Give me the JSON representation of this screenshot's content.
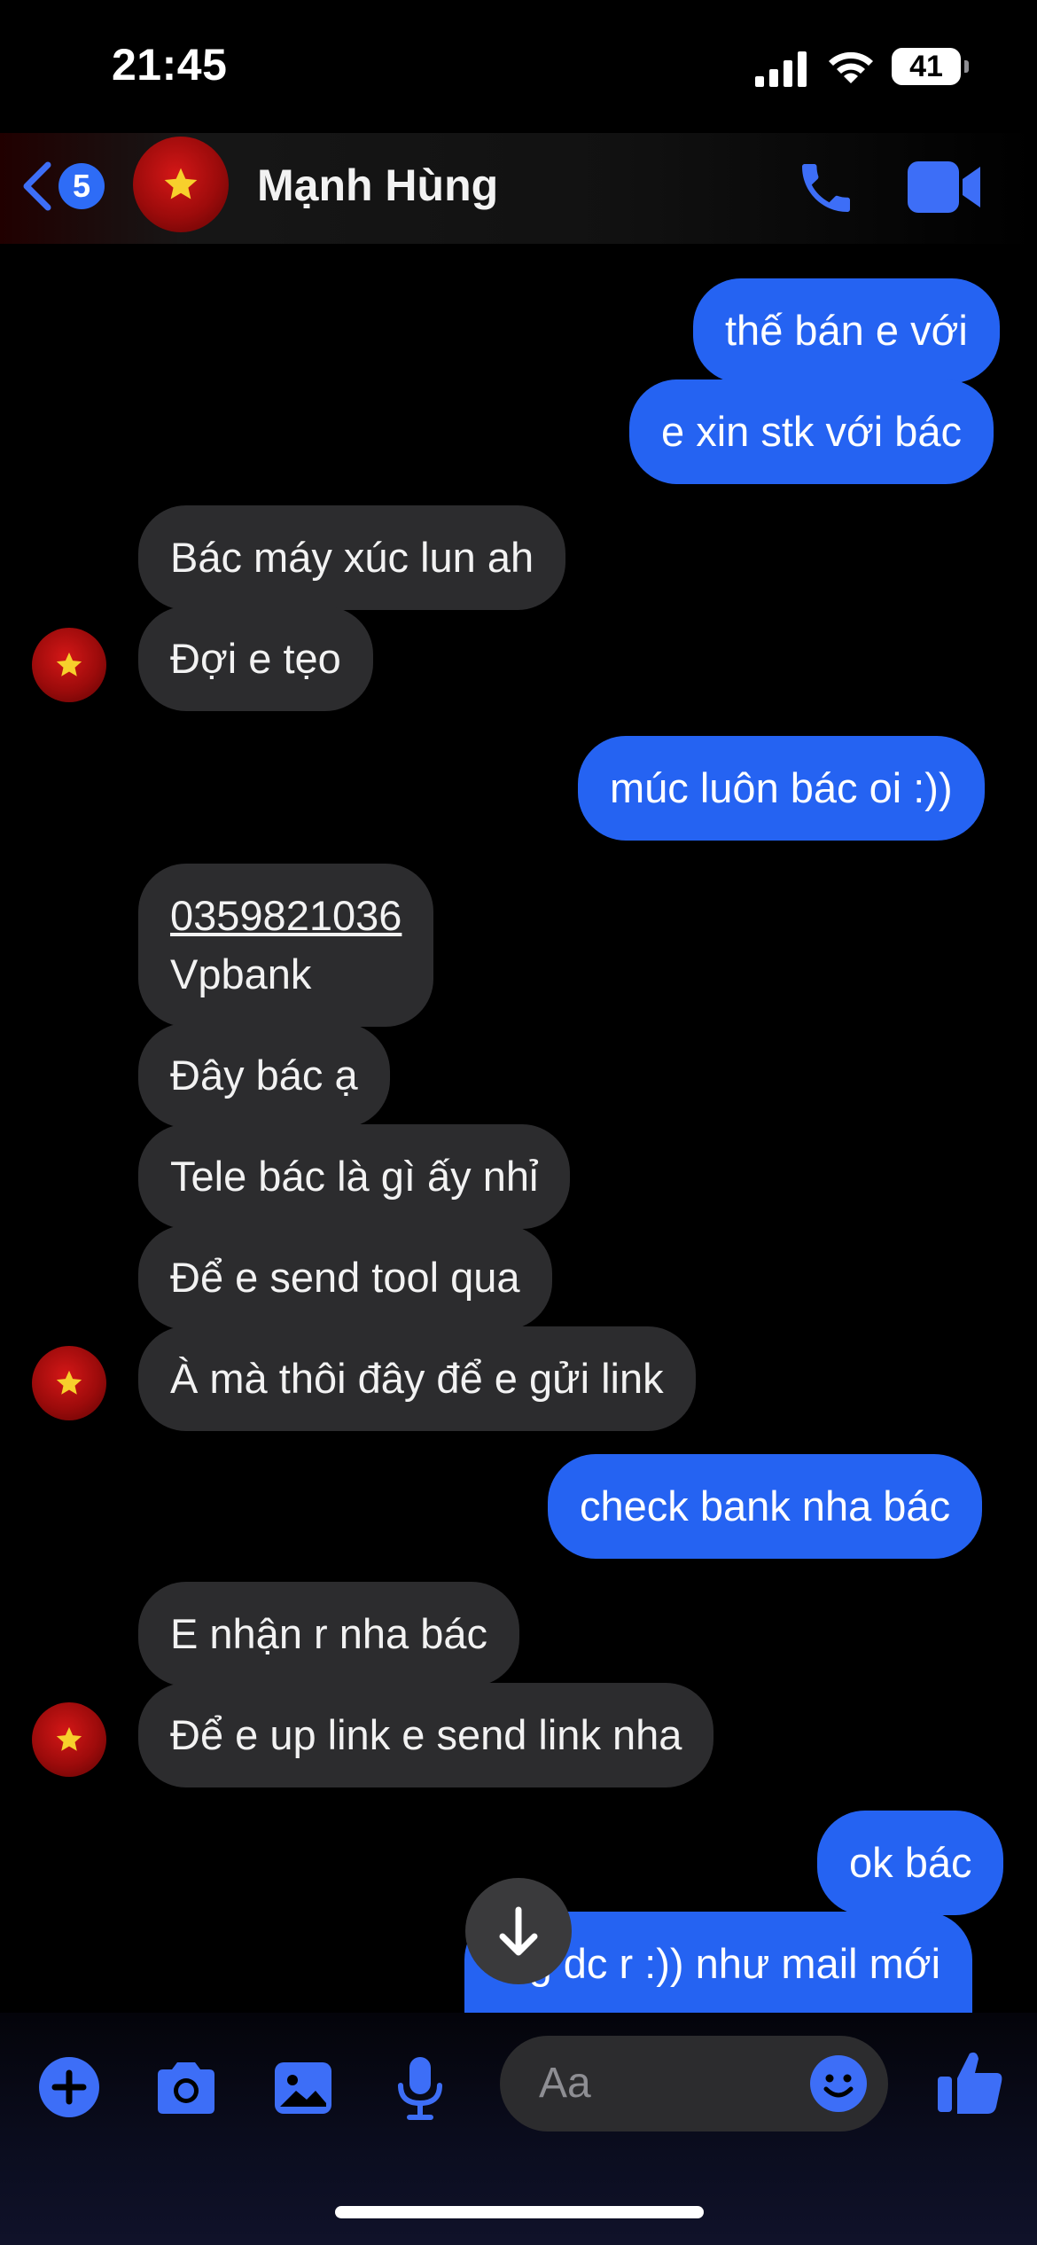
{
  "status_bar": {
    "time": "21:45",
    "battery": "41"
  },
  "header": {
    "back_count": "5",
    "contact_name": "Mạnh Hùng"
  },
  "messages": [
    {
      "from": "me",
      "text": "thế bán e với"
    },
    {
      "from": "me",
      "text": "e xin stk với bác"
    },
    {
      "from": "them",
      "text": "Bác máy xúc lun ah"
    },
    {
      "from": "them",
      "text": "Đợi e tẹo"
    },
    {
      "from": "me",
      "text": "múc luôn bác oi :))"
    },
    {
      "from": "them",
      "phone": "0359821036",
      "text": "Vpbank"
    },
    {
      "from": "them",
      "text": "Đây bác ạ"
    },
    {
      "from": "them",
      "text": "Tele bác là gì ấy nhỉ"
    },
    {
      "from": "them",
      "text": "Để e send tool qua"
    },
    {
      "from": "them",
      "text": "À mà thôi đây để e gửi link"
    },
    {
      "from": "me",
      "text": "check bank nha bác"
    },
    {
      "from": "them",
      "text": "E nhận r nha bác"
    },
    {
      "from": "them",
      "text": "Để e up link e send link nha"
    },
    {
      "from": "me",
      "text": "ok bác"
    },
    {
      "from": "me",
      "text": "log dc r :)) như mail mới"
    }
  ],
  "composer": {
    "placeholder": "Aa"
  },
  "colors": {
    "outgoing": "#2563f2",
    "incoming": "#2c2c2e",
    "accent": "#3d6ef7"
  },
  "icons": [
    "back-chevron-icon",
    "phone-icon",
    "video-icon",
    "plus-icon",
    "camera-icon",
    "image-icon",
    "microphone-icon",
    "emoji-icon",
    "thumbs-up-icon",
    "arrow-down-icon",
    "star-icon"
  ]
}
